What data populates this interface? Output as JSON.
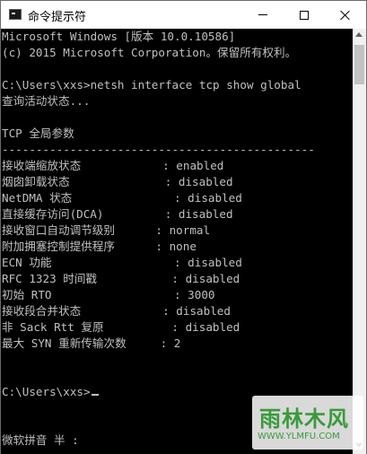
{
  "window": {
    "title": "命令提示符",
    "icon": "cmd-icon"
  },
  "console": {
    "lines": [
      "Microsoft Windows [版本 10.0.10586]",
      "(c) 2015 Microsoft Corporation。保留所有权利。",
      "",
      "C:\\Users\\xxs>netsh interface tcp show global",
      "查询活动状态...",
      "",
      "TCP 全局参数",
      "----------------------------------------------",
      "接收端缩放状态            : enabled",
      "烟囱卸载状态              : disabled",
      "NetDMA 状态               : disabled",
      "直接缓存访问(DCA)         : disabled",
      "接收窗口自动调节级别      : normal",
      "附加拥塞控制提供程序      : none",
      "ECN 功能                  : disabled",
      "RFC 1323 时间戳           : disabled",
      "初始 RTO                  : 3000",
      "接收段合并状态            : disabled",
      "非 Sack Rtt 复原          : disabled",
      "最大 SYN 重新传输次数     : 2",
      "",
      "",
      "C:\\Users\\xxs>",
      "",
      "",
      "微软拼音 半 :"
    ]
  },
  "watermark": {
    "main": "雨林木风",
    "sub": "WWW.YLMFU.COM"
  }
}
